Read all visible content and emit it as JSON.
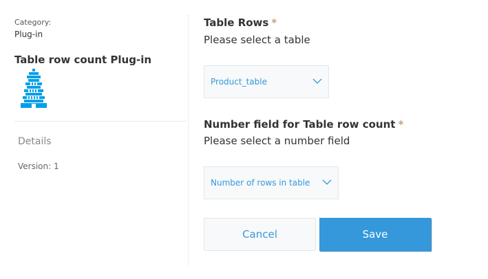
{
  "sidebar": {
    "category_label": "Category:",
    "category_value": "Plug-in",
    "plugin_name": "Table row count Plug-in",
    "plugin_icon": "pagoda-icon",
    "details_label": "Details",
    "version": "Version: 1"
  },
  "form": {
    "table_rows": {
      "title": "Table Rows",
      "required_mark": "*",
      "description": "Please select a table",
      "selected": "Product_table"
    },
    "number_field": {
      "title": "Number field for Table row count",
      "required_mark": "*",
      "description": "Please select a number field",
      "selected": "Number of rows in table"
    }
  },
  "buttons": {
    "cancel": "Cancel",
    "save": "Save"
  },
  "colors": {
    "accent": "#3498db",
    "required": "#c5a177",
    "icon": "#00a0e9"
  }
}
